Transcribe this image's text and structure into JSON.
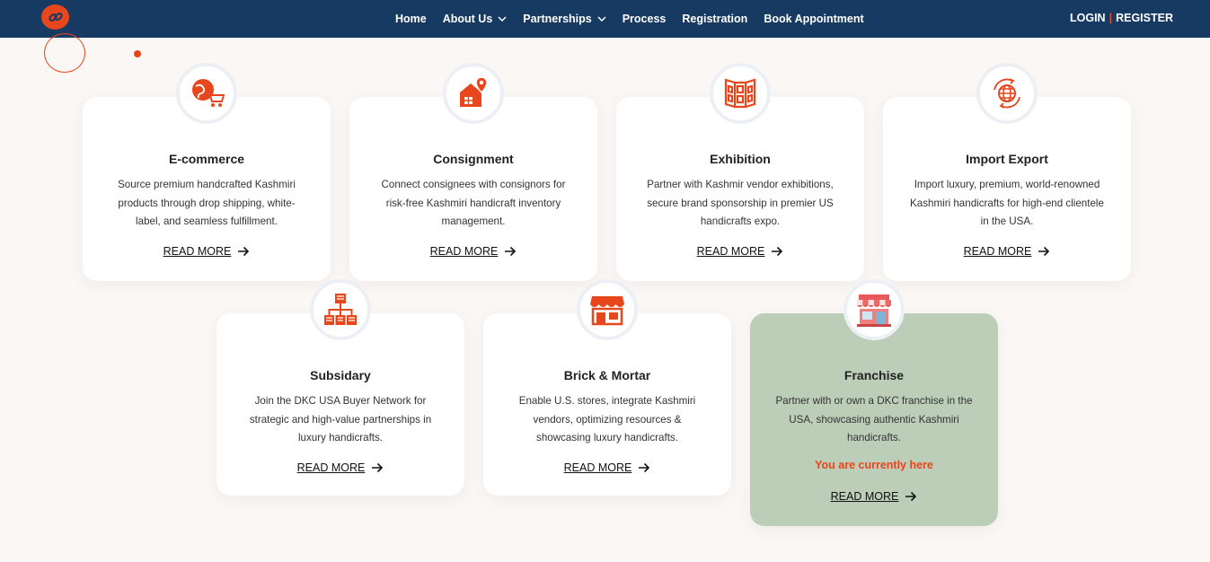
{
  "nav": {
    "logo": "link-logo-icon",
    "links": [
      "Home",
      "About Us",
      "Partnerships",
      "Process",
      "Registration",
      "Book Appointment"
    ],
    "login": "LOGIN",
    "separator": "|",
    "register": "REGISTER"
  },
  "cards": [
    {
      "title": "E-commerce",
      "description": "Source premium handcrafted Kashmiri products through drop shipping, white-label, and seamless fulfillment.",
      "read_more": "READ MORE",
      "icon": "globe-cart-icon"
    },
    {
      "title": "Consignment",
      "description": "Connect consignees with consignors for risk-free Kashmiri handicraft inventory management.",
      "read_more": "READ MORE",
      "icon": "house-location-icon"
    },
    {
      "title": "Exhibition",
      "description": "Partner with Kashmir vendor exhibitions, secure brand sponsorship in premier US handicrafts expo.",
      "read_more": "READ MORE",
      "icon": "folding-screen-icon"
    },
    {
      "title": "Import Export",
      "description": "Import luxury, premium, world-renowned Kashmiri handicrafts for high-end clientele in the USA.",
      "read_more": "READ MORE",
      "icon": "globe-arrows-icon"
    },
    {
      "title": "Subsidary",
      "description": "Join the DKC USA Buyer Network for strategic and high-value partnerships in luxury handicrafts.",
      "read_more": "READ MORE",
      "icon": "org-chart-icon"
    },
    {
      "title": "Brick & Mortar",
      "description": "Enable U.S. stores, integrate Kashmiri vendors, optimizing resources & showcasing luxury handicrafts.",
      "read_more": "READ MORE",
      "icon": "storefront-icon"
    },
    {
      "title": "Franchise",
      "description": "Partner with or own a DKC franchise in the USA, showcasing authentic Kashmiri handicrafts.",
      "current_label": "You are currently here",
      "read_more": "READ MORE",
      "icon": "shop-awning-icon"
    }
  ],
  "colors": {
    "accent": "#e8461c",
    "navbar": "#173a63",
    "active_card": "#bccdb8"
  }
}
